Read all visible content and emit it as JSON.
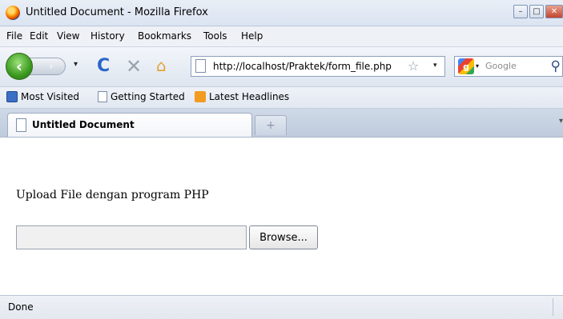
{
  "window": {
    "title": "Untitled Document - Mozilla Firefox",
    "minimize": "–",
    "maximize": "□",
    "close": "✕"
  },
  "menu": {
    "items": [
      "File",
      "Edit",
      "View",
      "History",
      "Bookmarks",
      "Tools",
      "Help"
    ]
  },
  "nav": {
    "back": "‹",
    "forward": "›",
    "dropdown": "▾",
    "reload": "C",
    "stop": "✕",
    "home": "⌂",
    "url": "http://localhost/Praktek/form_file.php",
    "bookmark_star": "☆",
    "url_dropdown": "▾"
  },
  "search": {
    "engine": "g",
    "engine_dropdown": "▾",
    "placeholder": "Google",
    "go": "⚲"
  },
  "bookmarks": {
    "items": [
      "Most Visited",
      "Getting Started",
      "Latest Headlines"
    ]
  },
  "tabs": {
    "active_label": "Untitled Document",
    "new_tab": "+",
    "list": "▾"
  },
  "page": {
    "heading": "Upload File dengan program PHP",
    "file_value": "",
    "browse_label": "Browse..."
  },
  "status": {
    "text": "Done"
  }
}
